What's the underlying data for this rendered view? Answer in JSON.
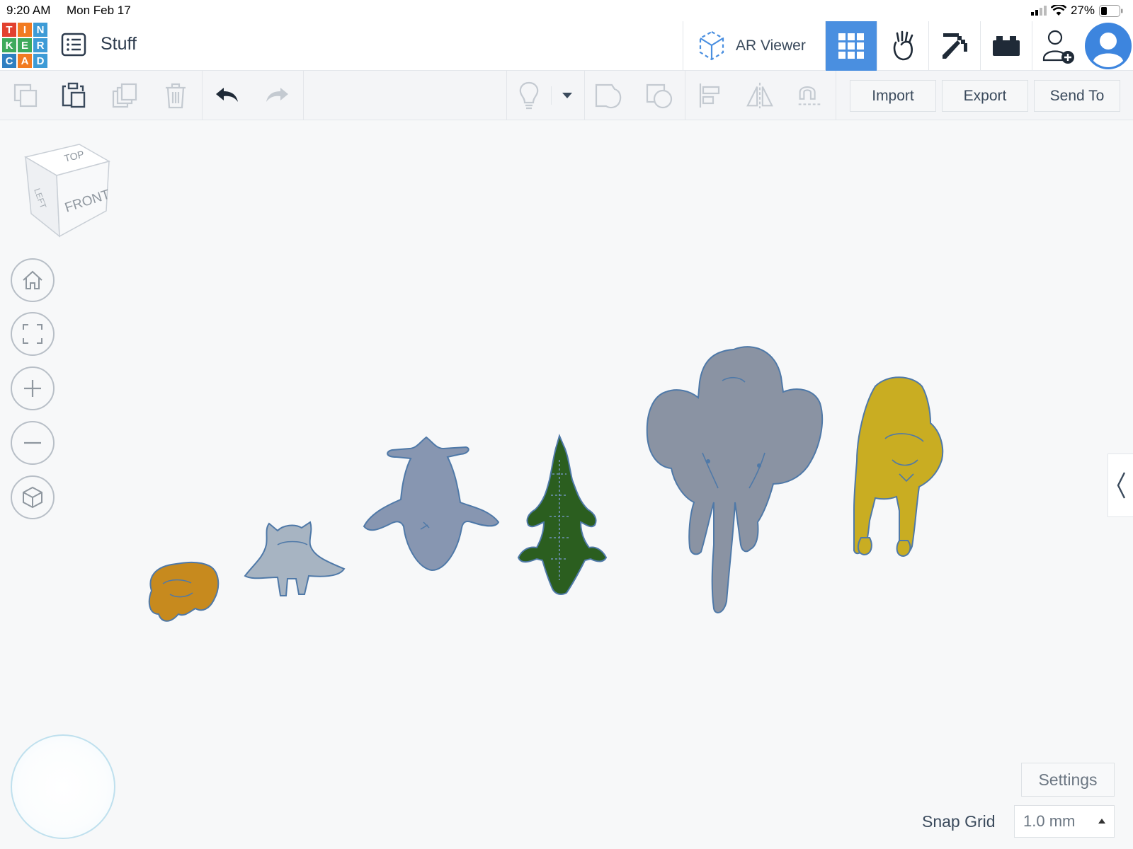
{
  "status_bar": {
    "time": "9:20 AM",
    "date": "Mon Feb 17",
    "battery": "27%"
  },
  "header": {
    "logo_letters": [
      "T",
      "I",
      "N",
      "K",
      "E",
      "R",
      "C",
      "A",
      "D"
    ],
    "logo_colors": [
      "#e2412f",
      "#f27b21",
      "#3d9bd6",
      "#3daa5c",
      "#3daa5c",
      "#3d9bd6",
      "#2f7fc1",
      "#f27b21",
      "#3d9bd6"
    ],
    "title": "Stuff",
    "ar_viewer_label": "AR Viewer",
    "accent": "#4a8fe0"
  },
  "toolbar": {
    "import_label": "Import",
    "export_label": "Export",
    "send_to_label": "Send To"
  },
  "view_cube": {
    "top": "TOP",
    "left": "LEFT",
    "front": "FRONT"
  },
  "scene": {
    "objects": [
      {
        "name": "frog",
        "color": "#c78a1e"
      },
      {
        "name": "walrus",
        "color": "#a7b4c2"
      },
      {
        "name": "whale",
        "color": "#8796b1"
      },
      {
        "name": "crocodile",
        "color": "#2b5e1f"
      },
      {
        "name": "elephant",
        "color": "#8a93a3"
      },
      {
        "name": "lion",
        "color": "#c9ad22"
      }
    ]
  },
  "bottom_right": {
    "settings_label": "Settings",
    "snap_grid_label": "Snap Grid",
    "snap_grid_value": "1.0 mm"
  }
}
